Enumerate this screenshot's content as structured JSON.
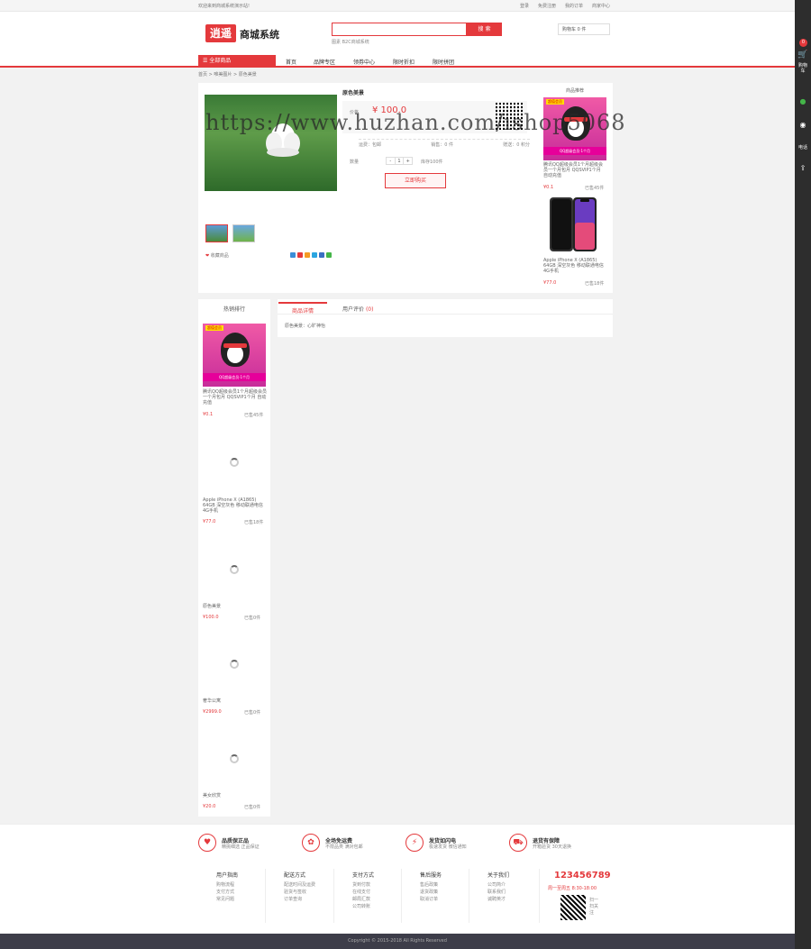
{
  "topbar": {
    "welcome": "欢迎来到商城系统演示站!",
    "links": [
      "登录",
      "免费注册",
      "我的订单",
      "商家中心"
    ]
  },
  "header": {
    "logo_mark": "逍遥",
    "logo_text": "商城系统",
    "search_placeholder": "",
    "search_button": "搜 索",
    "hot_words": "图素  B2C商城系统",
    "cart": "购物车  0 件"
  },
  "nav": {
    "all_categories": "全部商品",
    "items": [
      "首页",
      "品牌专区",
      "领券中心",
      "限时折扣",
      "限时拼团"
    ]
  },
  "breadcrumb": "首页 > 唯美图片 > 原色美景",
  "product": {
    "name": "原色美景",
    "price_label": "价格",
    "price": "¥ 100.0",
    "shipping": "运费：包邮",
    "sales": "销售：0 件",
    "points": "赠送：0 积分",
    "qty_label": "数量",
    "qty_minus": "-",
    "qty_value": "1",
    "qty_plus": "+",
    "stock": "库存100件",
    "buy_button": "立即购买",
    "favorite": "收藏商品"
  },
  "recommend": {
    "title": "商品推荐",
    "items": [
      {
        "name": "腾讯QQ超级会员1个月超级会员一个月包月 QQSVIP1个月 自动充值",
        "price": "¥0.1",
        "sold": "已售45件"
      },
      {
        "name": "Apple iPhone X (A1865) 64GB 深空灰色 移动联通电信4G手机",
        "price": "¥77.0",
        "sold": "已售18件"
      }
    ]
  },
  "card": {
    "tag": "超值会员",
    "band": "QQ超级会员·1个月"
  },
  "sidebar": {
    "title": "热销排行",
    "items": [
      {
        "name": "腾讯QQ超级会员1个月超级会员一个月包月 QQSVIP1个月 自动充值",
        "price": "¥0.1",
        "sold": "已售45件"
      },
      {
        "name": "Apple iPhone X (A1865) 64GB 深空灰色 移动联通电信4G手机",
        "price": "¥77.0",
        "sold": "已售18件"
      },
      {
        "name": "原色美景",
        "price": "¥100.0",
        "sold": "已售0件"
      },
      {
        "name": "奢华公寓",
        "price": "¥2999.0",
        "sold": "已售0件"
      },
      {
        "name": "美女欣赏",
        "price": "¥20.0",
        "sold": "已售0件"
      }
    ]
  },
  "tabs": {
    "details": "商品详情",
    "reviews": "用户评价",
    "review_count": "(0)",
    "body": "原色美景：心旷神怡"
  },
  "services": [
    {
      "title": "品质保正品",
      "sub": "精挑细选 正品保证",
      "icon": "shield-icon",
      "glyph": "♥"
    },
    {
      "title": "全场免运费",
      "sub": "不限品类 满对包邮",
      "icon": "gift-icon",
      "glyph": "✿"
    },
    {
      "title": "发货如闪电",
      "sub": "极速发货 微信通知",
      "icon": "lightning-icon",
      "glyph": "⚡"
    },
    {
      "title": "退货有保障",
      "sub": "开箱验货 30天退换",
      "icon": "truck-icon",
      "glyph": "⛟"
    }
  ],
  "footer": {
    "columns": [
      {
        "heading": "用户指南",
        "links": [
          "购物流程",
          "支付方式",
          "常见问题"
        ]
      },
      {
        "heading": "配送方式",
        "links": [
          "配送时间及运费",
          "验货与签收",
          "订单查询"
        ]
      },
      {
        "heading": "支付方式",
        "links": [
          "货到付款",
          "在线支付",
          "邮局汇款",
          "公司转账"
        ]
      },
      {
        "heading": "售后服务",
        "links": [
          "售后政策",
          "退货政策",
          "取消订单"
        ]
      },
      {
        "heading": "关于我们",
        "links": [
          "公司简介",
          "联系我们",
          "诚聘英才"
        ]
      }
    ],
    "hotline": "123456789",
    "hotline_time": "周一至周五  8:30-18:00",
    "qr_text": "扫一扫关注"
  },
  "copyright": "Copyright © 2015-2018 All Rights Reserved",
  "rightbar": {
    "badge": "0",
    "cart": "购物车",
    "phone": "电话"
  },
  "watermark": "https://www.huzhan.com/ishop5068",
  "colors": {
    "accent": "#e4393c",
    "rightbar": "#2d2d2d",
    "footer_bottom": "#3d3d49"
  }
}
